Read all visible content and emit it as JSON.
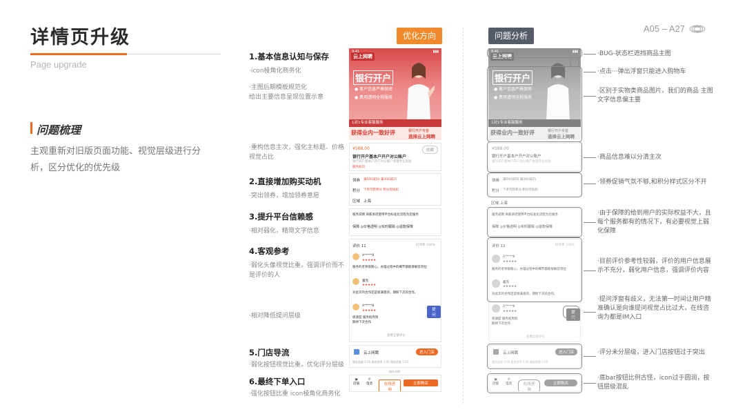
{
  "header": {
    "title": "详情页升级",
    "subtitle": "Page upgrade",
    "page_no": "A05 – A27"
  },
  "intro": {
    "heading": "问题梳理",
    "desc": "主观重新对旧版页面功能、视觉层级进行分析，区分优化的优先级"
  },
  "tags": {
    "optimize": "优化方向",
    "analysis": "问题分析"
  },
  "left_notes": [
    {
      "heading": "1.基本信息认知与保存",
      "lines": [
        "·icon棱角化商务化",
        "",
        "·主图后期模板规范化",
        " 给出主要信息呈现位置示意"
      ]
    },
    {
      "lines": [
        "·重构信息主次，强化主标题、价格",
        " 视觉占比"
      ]
    },
    {
      "heading": "2.直接增加购买动机",
      "lines": [
        "·突出领券，增加领券意愿"
      ]
    },
    {
      "heading": "3.提升平台信赖感",
      "lines": [
        "·相对弱化，精简文字信息"
      ]
    },
    {
      "heading": "4.客观参考",
      "lines": [
        "·弱化头像视觉比重，强调评价而不",
        " 是评价的人"
      ]
    },
    {
      "lines": [
        "·相对降低提问层级"
      ]
    },
    {
      "heading": "5.门店导流",
      "lines": [
        "·弱化按钮视觉比重，优化评分层级"
      ]
    },
    {
      "heading": "6.最终下单入口",
      "lines": [
        "·强化按钮比重    icon棱角化商务化"
      ]
    }
  ],
  "right_notes": [
    "·BUG-状态栏遮挡商品主图",
    "·点击···弹出浮窗只能进入购物车",
    "·区别于实物类商品图片，我们的商品  主图文字信息偏主要",
    "·商品信息难以分清主次",
    "·领券促销气氛不够,和积分样式区分不开",
    "·由于保障的给到用户的实际权益不大，且每个服务都有的情况下，有必要视觉上弱化保障",
    "·目前评价参考性较弱，评价的用户信息展示不充分，弱化用户信息，强调评价内容",
    "·提问浮窗有歧义，无法第一时间让用户精准确认是向谁提问视觉占比过大，在线咨询为都是IM入口",
    "·评分未分层级，进入门店按钮过于突出",
    "·底bar按钮比例古怪，icon过于圆润，按钮层级混乱"
  ],
  "phone": {
    "status_time": "9:41",
    "logo": "云上网聘",
    "banner_title": "银行开户",
    "banner_b1": "客户信息严格保密",
    "banner_b2": "费用透明全程服务",
    "stripe": "1对1专业客服服务",
    "foot_left": "获得业内一致好评",
    "foot_right_1": "银行开户专首",
    "foot_right_2": "选择云上网聘",
    "price": "¥588.00",
    "fav": "收藏",
    "product_title": "银行开户基本户开户对公账户",
    "product_sub": "银行开户基本户开户对公账户办理专业高效",
    "product_badge": "服务标识",
    "coupon_label": "领券",
    "coupon_val": "满500减50  满300减25",
    "points_label": "积分",
    "points_val": "下单可获积分 积分可抵扣",
    "region_label": "区域",
    "region_val": "上海",
    "guarantee_label": "服务说明",
    "guarantee_desc": "商家承诺使用平台标准化流程为您服务",
    "guarantee_title": "保障",
    "g1": "价格透明",
    "g2": "实时跟踪",
    "g3": "退款保障",
    "review_title": "评价 11",
    "review_rate": "好评率 100%",
    "r1_name": "A*****8",
    "r1_text": "服务的老师很耐心，办理过程中的细节都能够解答到位",
    "r2_name": "蕾克",
    "r2_text": "对此次的合作还是很满意的，期盼下次的合作。",
    "r3_name": "A*****8",
    "r3_text_1": "很速度  服务很周到",
    "r3_text_2": "期待下次合作",
    "ask_btn": "提问",
    "view_all": "查看全部评价",
    "store_name": "云上网聘",
    "store_btn": "进入门店",
    "score_1": "服务态度 5.00",
    "score_2": "服务效率 5.00",
    "score_3": "服务质量 5.00",
    "detail_hint": "服务详情",
    "bar_store": "店铺",
    "bar_call": "电话",
    "bar_consult": "在线咨询",
    "bar_buy": "立即购买"
  },
  "colors": {
    "accent": "#ee6a24",
    "tag_orange": "#f08a2a",
    "tag_gray": "#555b68",
    "banner_red": "#d94a4a"
  }
}
